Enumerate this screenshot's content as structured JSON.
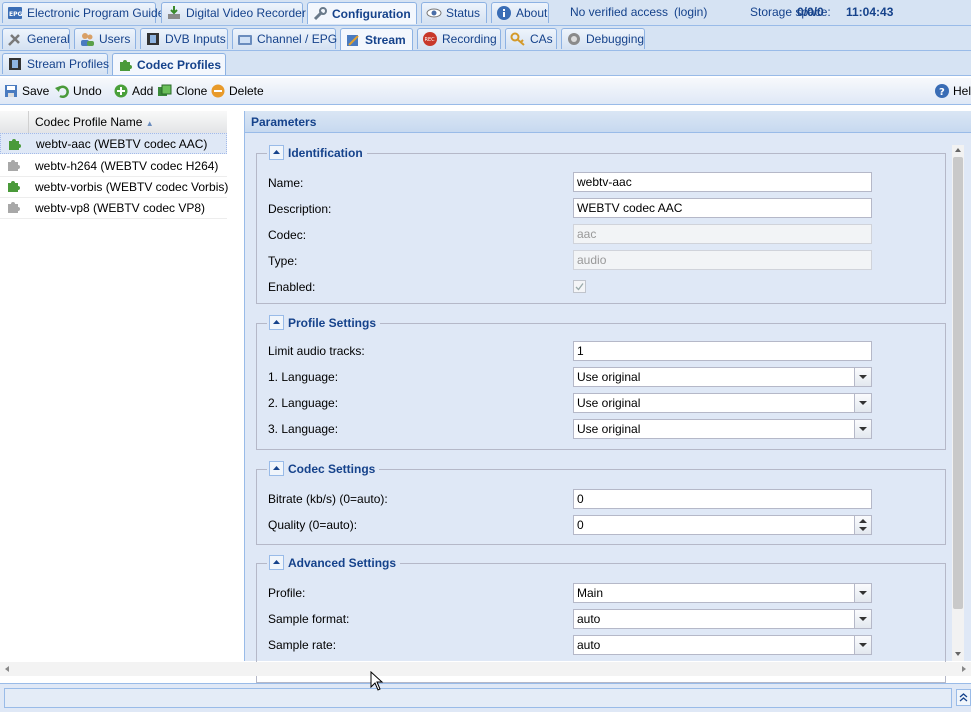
{
  "topnav": {
    "tabs": [
      {
        "label": "Electronic Program Guide",
        "icon": "epg-icon"
      },
      {
        "label": "Digital Video Recorder",
        "icon": "recorder-icon"
      },
      {
        "label": "Configuration",
        "icon": "wrench-icon"
      },
      {
        "label": "Status",
        "icon": "eye-icon"
      },
      {
        "label": "About",
        "icon": "info-icon"
      }
    ],
    "access_text": "No verified access",
    "login_link": "(login)",
    "storage_label": "Storage space:",
    "storage_value": "0/0/0",
    "time": "11:04:43"
  },
  "config_tabs": [
    {
      "label": "General",
      "icon": "tools-icon"
    },
    {
      "label": "Users",
      "icon": "users-icon"
    },
    {
      "label": "DVB Inputs",
      "icon": "film-icon"
    },
    {
      "label": "Channel / EPG",
      "icon": "tv-icon"
    },
    {
      "label": "Stream",
      "icon": "stream-icon"
    },
    {
      "label": "Recording",
      "icon": "rec-icon"
    },
    {
      "label": "CAs",
      "icon": "key-icon"
    },
    {
      "label": "Debugging",
      "icon": "bug-icon"
    }
  ],
  "stream_tabs": [
    {
      "label": "Stream Profiles",
      "icon": "film-icon"
    },
    {
      "label": "Codec Profiles",
      "icon": "puzzle-icon"
    }
  ],
  "toolbar": {
    "save": "Save",
    "undo": "Undo",
    "add": "Add",
    "clone": "Clone",
    "delete": "Delete",
    "help": "Help"
  },
  "grid": {
    "column": "Codec Profile Name",
    "rows": [
      {
        "name": "webtv-aac (WEBTV codec AAC)",
        "enabled": true
      },
      {
        "name": "webtv-h264 (WEBTV codec H264)",
        "enabled": false
      },
      {
        "name": "webtv-vorbis (WEBTV codec Vorbis)",
        "enabled": true
      },
      {
        "name": "webtv-vp8 (WEBTV codec VP8)",
        "enabled": false
      }
    ]
  },
  "params": {
    "title": "Parameters",
    "identification": {
      "legend": "Identification",
      "name_label": "Name:",
      "name_value": "webtv-aac",
      "desc_label": "Description:",
      "desc_value": "WEBTV codec AAC",
      "codec_label": "Codec:",
      "codec_value": "aac",
      "type_label": "Type:",
      "type_value": "audio",
      "enabled_label": "Enabled:"
    },
    "profile_settings": {
      "legend": "Profile Settings",
      "limit_label": "Limit audio tracks:",
      "limit_value": "1",
      "lang1_label": "1. Language:",
      "lang1_value": "Use original",
      "lang2_label": "2. Language:",
      "lang2_value": "Use original",
      "lang3_label": "3. Language:",
      "lang3_value": "Use original"
    },
    "codec_settings": {
      "legend": "Codec Settings",
      "bitrate_label": "Bitrate (kb/s) (0=auto):",
      "bitrate_value": "0",
      "quality_label": "Quality (0=auto):",
      "quality_value": "0"
    },
    "advanced_settings": {
      "legend": "Advanced Settings",
      "profile_label": "Profile:",
      "profile_value": "Main",
      "sample_format_label": "Sample format:",
      "sample_format_value": "auto",
      "sample_rate_label": "Sample rate:",
      "sample_rate_value": "auto"
    }
  },
  "colors": {
    "accent": "#15428b",
    "panel": "#dfe8f6",
    "border": "#99bbe8"
  }
}
